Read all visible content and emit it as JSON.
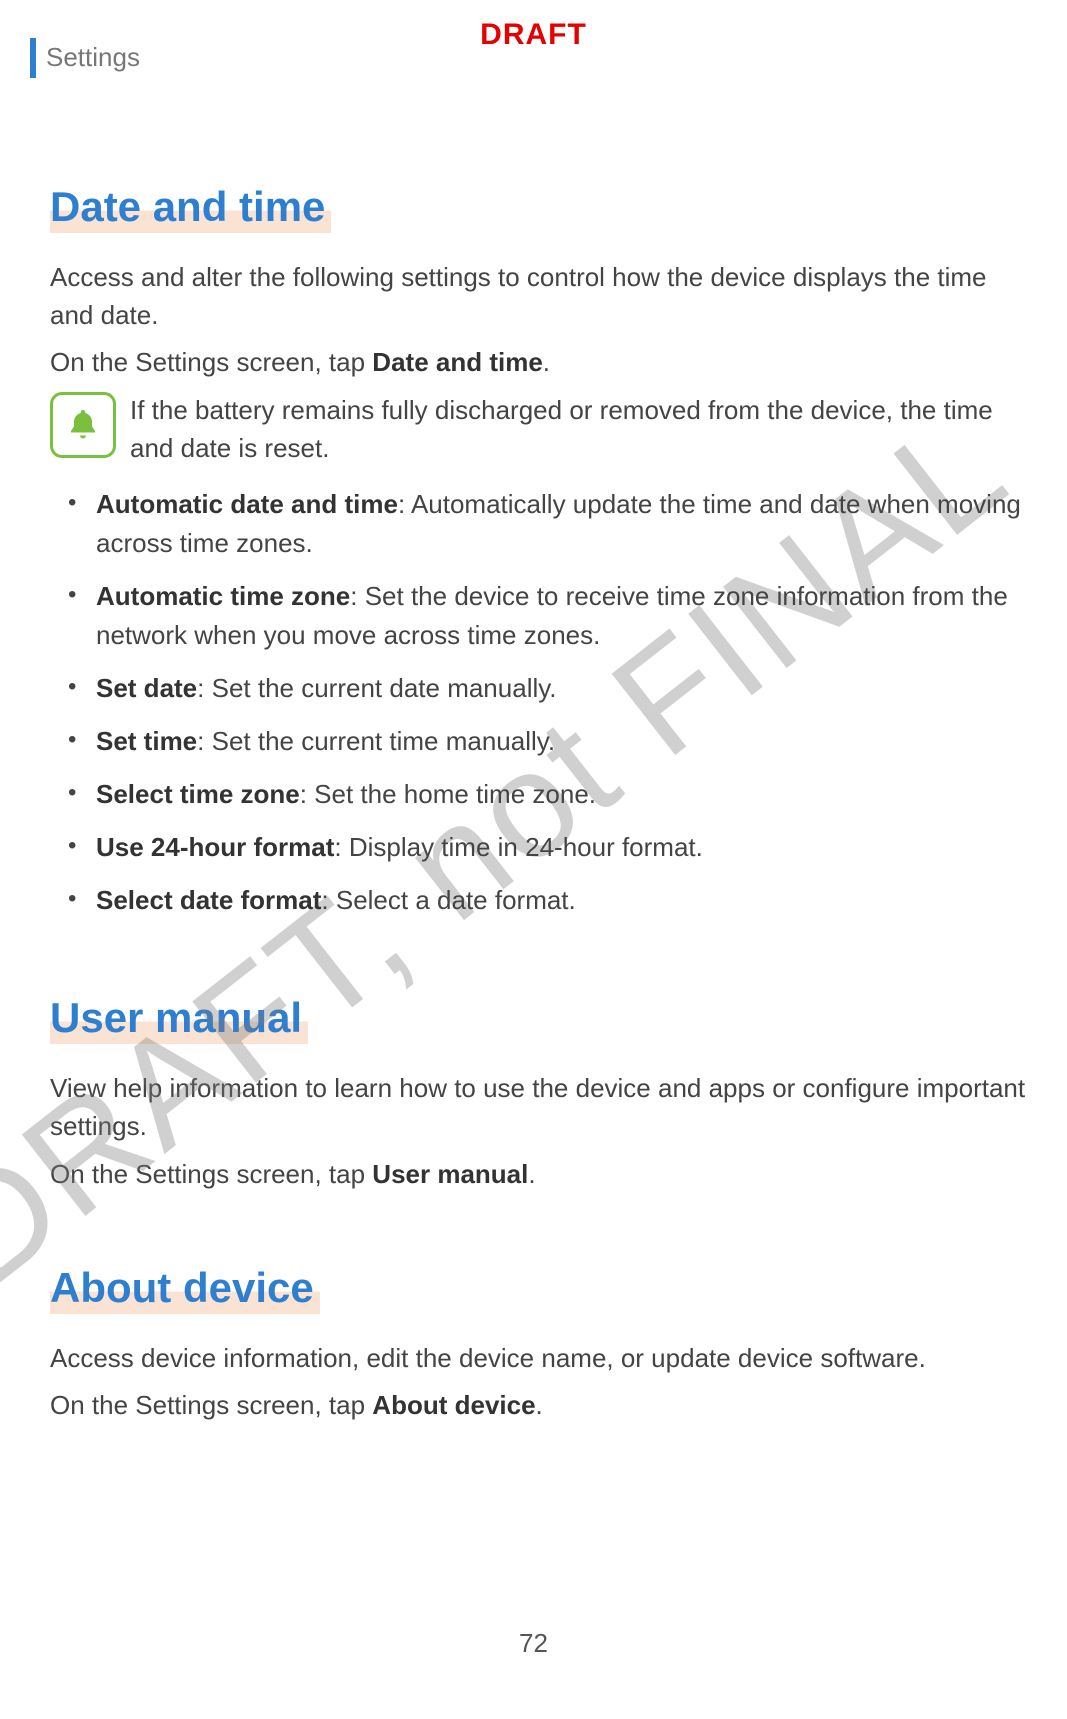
{
  "draft_label": "DRAFT",
  "watermark": "DRAFT, not FINAL",
  "header": "Settings",
  "page_number": "72",
  "sections": {
    "date_time": {
      "title": "Date and time",
      "intro": "Access and alter the following settings to control how the device displays the time and date.",
      "nav_prefix": "On the Settings screen, tap ",
      "nav_bold": "Date and time",
      "nav_suffix": ".",
      "note": "If the battery remains fully discharged or removed from the device, the time and date is reset.",
      "items": [
        {
          "term": "Automatic date and time",
          "desc": ": Automatically update the time and date when moving across time zones."
        },
        {
          "term": "Automatic time zone",
          "desc": ": Set the device to receive time zone information from the network when you move across time zones."
        },
        {
          "term": "Set date",
          "desc": ": Set the current date manually."
        },
        {
          "term": "Set time",
          "desc": ": Set the current time manually."
        },
        {
          "term": "Select time zone",
          "desc": ": Set the home time zone."
        },
        {
          "term": "Use 24-hour format",
          "desc": ": Display time in 24-hour format."
        },
        {
          "term": "Select date format",
          "desc": ": Select a date format."
        }
      ]
    },
    "user_manual": {
      "title": "User manual",
      "intro": "View help information to learn how to use the device and apps or configure important settings.",
      "nav_prefix": "On the Settings screen, tap ",
      "nav_bold": "User manual",
      "nav_suffix": "."
    },
    "about_device": {
      "title": "About device",
      "intro": "Access device information, edit the device name, or update device software.",
      "nav_prefix": "On the Settings screen, tap ",
      "nav_bold": "About device",
      "nav_suffix": "."
    }
  }
}
